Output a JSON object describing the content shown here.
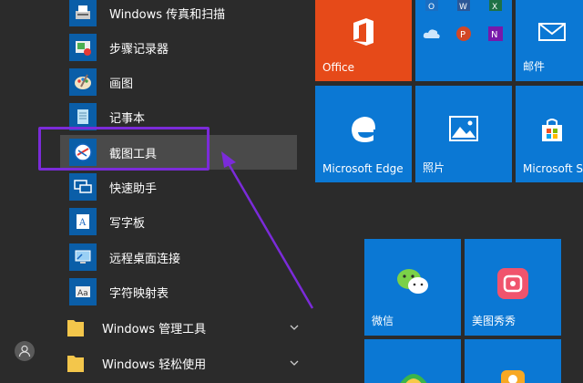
{
  "app_list": [
    {
      "label": "Windows 传真和扫描",
      "icon": "fax-scanner-icon"
    },
    {
      "label": "步骤记录器",
      "icon": "steps-recorder-icon"
    },
    {
      "label": "画图",
      "icon": "paint-icon"
    },
    {
      "label": "记事本",
      "icon": "notepad-icon"
    },
    {
      "label": "截图工具",
      "icon": "snipping-tool-icon",
      "highlighted": true
    },
    {
      "label": "快速助手",
      "icon": "quick-assist-icon"
    },
    {
      "label": "写字板",
      "icon": "wordpad-icon"
    },
    {
      "label": "远程桌面连接",
      "icon": "remote-desktop-icon"
    },
    {
      "label": "字符映射表",
      "icon": "character-map-icon"
    }
  ],
  "folders": [
    {
      "label": "Windows 管理工具",
      "icon": "folder-icon"
    },
    {
      "label": "Windows 轻松使用",
      "icon": "folder-icon"
    }
  ],
  "tiles": {
    "office": "Office",
    "mail": "邮件",
    "edge": "Microsoft Edge",
    "photos": "照片",
    "store": "Microsoft S",
    "wechat": "微信",
    "meitu": "美图秀秀"
  },
  "colors": {
    "background": "#2b2b2b",
    "tile_blue": "#0b78d4",
    "office_red": "#e64a19",
    "highlight_frame": "#7b2bd9"
  }
}
